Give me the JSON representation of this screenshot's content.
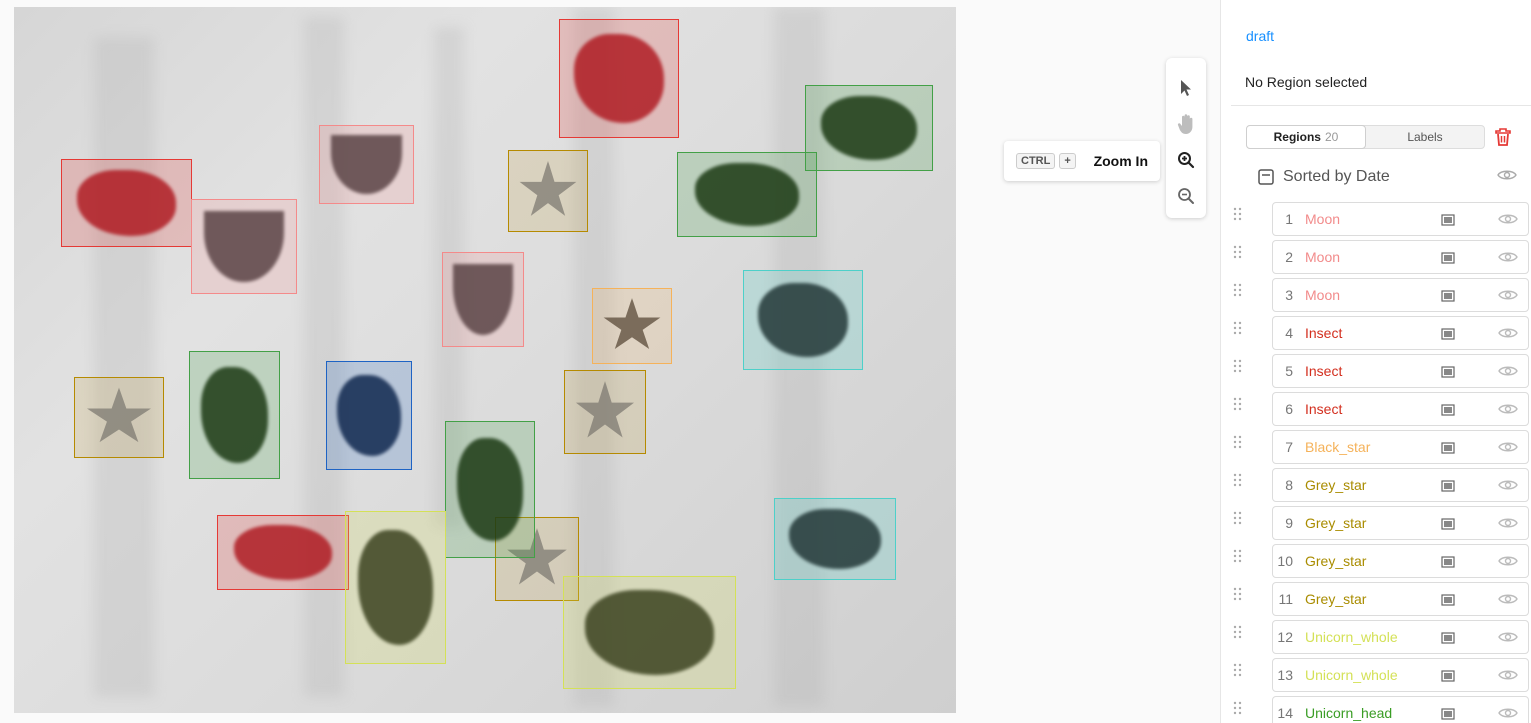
{
  "canvas": {
    "regions": [
      {
        "label": "Insect",
        "color": "#e53935",
        "fill": "rgba(229,57,53,0.22)"
      },
      {
        "label": "Insect",
        "color": "#e53935",
        "fill": "rgba(229,57,53,0.22)"
      },
      {
        "label": "Insect",
        "color": "#e53935",
        "fill": "rgba(229,57,53,0.22)"
      },
      {
        "label": "Moon",
        "color": "#f48a8a",
        "fill": "rgba(244,138,138,0.20)"
      },
      {
        "label": "Moon",
        "color": "#f48a8a",
        "fill": "rgba(244,138,138,0.20)"
      },
      {
        "label": "Moon",
        "color": "#f48a8a",
        "fill": "rgba(244,138,138,0.20)"
      },
      {
        "label": "Grey_star",
        "color": "#b58a00",
        "fill": "rgba(181,138,0,0.14)"
      },
      {
        "label": "Grey_star",
        "color": "#b58a00",
        "fill": "rgba(181,138,0,0.14)"
      },
      {
        "label": "Grey_star",
        "color": "#b58a00",
        "fill": "rgba(181,138,0,0.14)"
      },
      {
        "label": "Grey_star",
        "color": "#b58a00",
        "fill": "rgba(181,138,0,0.14)"
      },
      {
        "label": "Black_star",
        "color": "#f5b25a",
        "fill": "rgba(245,178,90,0.18)"
      },
      {
        "label": "Unicorn_head",
        "color": "#43a047",
        "fill": "rgba(67,160,71,0.22)"
      },
      {
        "label": "Unicorn_head",
        "color": "#43a047",
        "fill": "rgba(67,160,71,0.22)"
      },
      {
        "label": "Unicorn_head",
        "color": "#43a047",
        "fill": "rgba(67,160,71,0.22)"
      },
      {
        "label": "Unicorn_head",
        "color": "#43a047",
        "fill": "rgba(67,160,71,0.22)"
      },
      {
        "label": "Unicorn_whole",
        "color": "#d4e157",
        "fill": "rgba(212,225,87,0.22)"
      },
      {
        "label": "Unicorn_whole",
        "color": "#d4e157",
        "fill": "rgba(212,225,87,0.22)"
      },
      {
        "label": "Blue",
        "color": "#1e63c4",
        "fill": "rgba(30,99,196,0.20)"
      },
      {
        "label": "Teal",
        "color": "#4dd0c9",
        "fill": "rgba(77,208,201,0.22)"
      },
      {
        "label": "Teal",
        "color": "#4dd0c9",
        "fill": "rgba(77,208,201,0.22)"
      }
    ]
  },
  "toolbar": {
    "tools": [
      {
        "name": "pointer-tool",
        "icon": "cursor-icon"
      },
      {
        "name": "pan-tool",
        "icon": "hand-icon"
      },
      {
        "name": "zoom-in-tool",
        "icon": "zoom-in-icon"
      },
      {
        "name": "zoom-out-tool",
        "icon": "zoom-out-icon"
      }
    ]
  },
  "tooltip": {
    "key1": "CTRL",
    "key2": "+",
    "label": "Zoom In"
  },
  "sidepanel": {
    "status": "draft",
    "selection_text": "No Region selected",
    "tabs": [
      {
        "label": "Regions",
        "count": "20",
        "active": true
      },
      {
        "label": "Labels",
        "count": "",
        "active": false
      }
    ],
    "sort_label": "Sorted by Date",
    "regions": [
      {
        "num": "1",
        "label": "Moon",
        "color": "#f28b8b"
      },
      {
        "num": "2",
        "label": "Moon",
        "color": "#f28b8b"
      },
      {
        "num": "3",
        "label": "Moon",
        "color": "#f28b8b"
      },
      {
        "num": "4",
        "label": "Insect",
        "color": "#d32f1f"
      },
      {
        "num": "5",
        "label": "Insect",
        "color": "#d32f1f"
      },
      {
        "num": "6",
        "label": "Insect",
        "color": "#d32f1f"
      },
      {
        "num": "7",
        "label": "Black_star",
        "color": "#f5b25a"
      },
      {
        "num": "8",
        "label": "Grey_star",
        "color": "#a98c00"
      },
      {
        "num": "9",
        "label": "Grey_star",
        "color": "#a98c00"
      },
      {
        "num": "10",
        "label": "Grey_star",
        "color": "#a98c00"
      },
      {
        "num": "11",
        "label": "Grey_star",
        "color": "#a98c00"
      },
      {
        "num": "12",
        "label": "Unicorn_whole",
        "color": "#d4e157"
      },
      {
        "num": "13",
        "label": "Unicorn_whole",
        "color": "#d4e157"
      },
      {
        "num": "14",
        "label": "Unicorn_head",
        "color": "#3a9d25"
      }
    ]
  }
}
